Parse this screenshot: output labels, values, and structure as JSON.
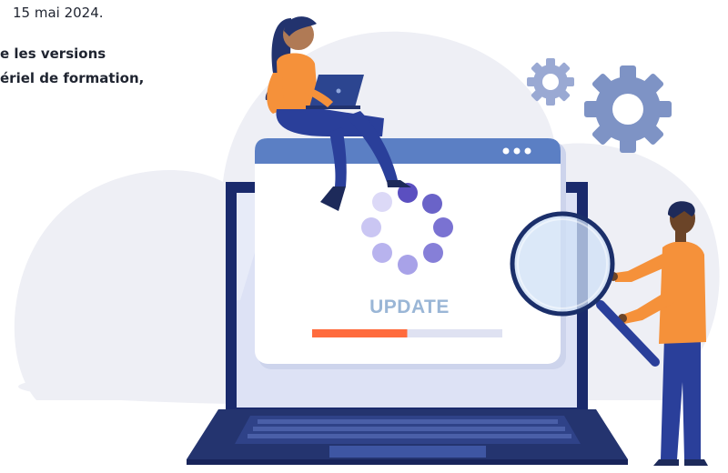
{
  "article": {
    "date_fragment": "15 mai 2024.",
    "line_1": "e les versions",
    "line_2": "ériel de formation,"
  },
  "illustration": {
    "screen_label": "UPDATE",
    "window_menu_icon": "three-dots-icon",
    "progress_fraction": 0.5,
    "colors": {
      "blob": "#eeeff5",
      "screen_frame": "#1a2a6c",
      "window_titlebar": "#5b7fc4",
      "progress": "#ff6b3d",
      "progress_track": "#dfe2f2",
      "gear": "#7e93c5",
      "spinner": "#6a63c8",
      "shirt": "#f5913a",
      "pants": "#2a3f9a"
    }
  }
}
